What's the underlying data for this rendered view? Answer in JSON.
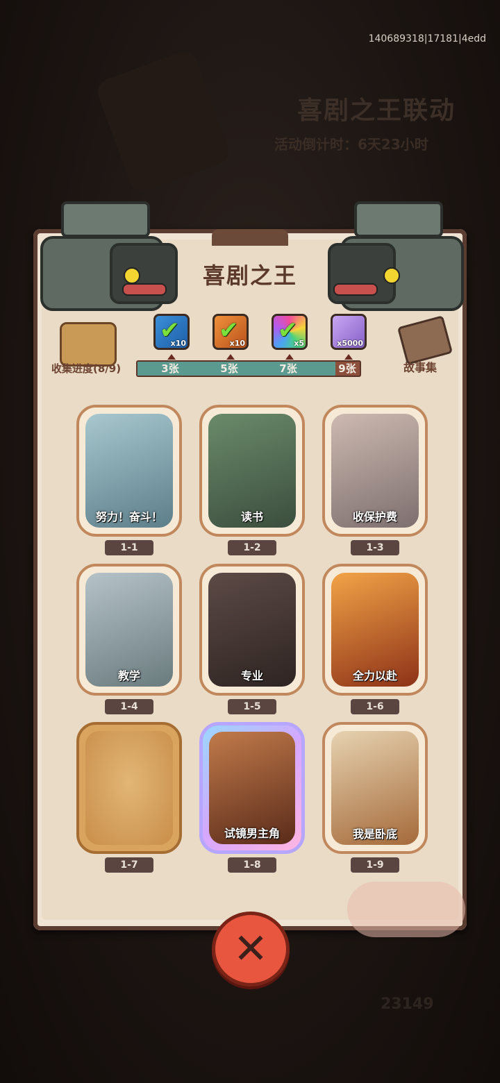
{
  "debug_id": "140689318|17181|4edd",
  "background": {
    "event_title": "喜剧之王联动",
    "timer_text": "活动倒计时：6天23小时",
    "currency_count": "23149"
  },
  "panel": {
    "title": "喜剧之王"
  },
  "collection": {
    "label": "收集进度(8/9)",
    "progress_fraction": 0.89
  },
  "story": {
    "label": "故事集"
  },
  "milestones": [
    {
      "label": "3张",
      "multiplier": "x10",
      "claimed": true,
      "icon": "chest-blue-icon"
    },
    {
      "label": "5张",
      "multiplier": "x10",
      "claimed": true,
      "icon": "chest-orange-icon"
    },
    {
      "label": "7张",
      "multiplier": "x5",
      "claimed": true,
      "icon": "gem-rainbow-icon"
    },
    {
      "label": "9张",
      "multiplier": "x5000",
      "claimed": false,
      "icon": "crystal-purple-icon"
    }
  ],
  "cards": [
    {
      "id": "1-1",
      "caption": "努力！奋斗！",
      "state": "collected"
    },
    {
      "id": "1-2",
      "caption": "读书",
      "state": "collected"
    },
    {
      "id": "1-3",
      "caption": "收保护费",
      "state": "collected"
    },
    {
      "id": "1-4",
      "caption": "教学",
      "state": "collected"
    },
    {
      "id": "1-5",
      "caption": "专业",
      "state": "collected"
    },
    {
      "id": "1-6",
      "caption": "全力以赴",
      "state": "collected"
    },
    {
      "id": "1-7",
      "caption": "",
      "state": "locked"
    },
    {
      "id": "1-8",
      "caption": "试镜男主角",
      "state": "collected-holo"
    },
    {
      "id": "1-9",
      "caption": "我是卧底",
      "state": "collected"
    }
  ],
  "colors": {
    "panel": "#efe4d3",
    "progress_fill": "#5b9a8f",
    "progress_track": "#8b4f3c",
    "close_button": "#e8563f",
    "check": "#7ce03c"
  }
}
